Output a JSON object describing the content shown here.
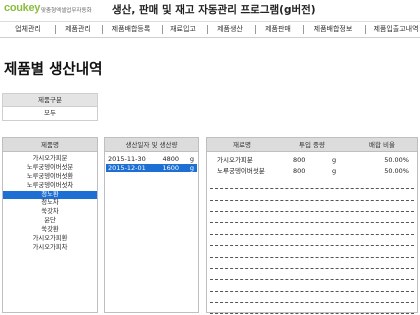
{
  "header": {
    "logo": "coukey",
    "logo_sub": "맞춤형엑셀업무자동화",
    "title": "생산, 판매 및 재고 자동관리 프로그램(g버전)"
  },
  "menu": [
    "업체관리",
    "제품관리",
    "제품배합등록",
    "재료입고",
    "제품생산",
    "제품판매",
    "제품배합정보",
    "제품입출고내역"
  ],
  "page_title": "제품별 생산내역",
  "filter": {
    "label": "제품구분",
    "value": "모두"
  },
  "products_panel": {
    "header": "제품명",
    "items": [
      "가시오가피분",
      "노루궁뎅이버섯분",
      "노루궁뎅이버섯환",
      "노루궁뎅이버섯차",
      "정노환",
      "청노차",
      "쑥갓차",
      "윤단",
      "쑥갓환",
      "가시오가피환",
      "가시오가피차"
    ],
    "selected_index": 4
  },
  "dates_panel": {
    "header": "생산일자 및 생산량",
    "rows": [
      {
        "date": "2015-11-30",
        "qty": "4800",
        "unit": "g"
      },
      {
        "date": "2015-12-01",
        "qty": "1600",
        "unit": "g"
      }
    ],
    "selected_index": 1
  },
  "materials_panel": {
    "headers": {
      "name": "재료명",
      "qty": "투입 중량",
      "ratio": "배합 비율"
    },
    "rows": [
      {
        "name": "가시오가피분",
        "qty": "800",
        "unit": "g",
        "ratio": "50.00%"
      },
      {
        "name": "노루궁뎅이버섯분",
        "qty": "800",
        "unit": "g",
        "ratio": "50.00%"
      }
    ]
  }
}
